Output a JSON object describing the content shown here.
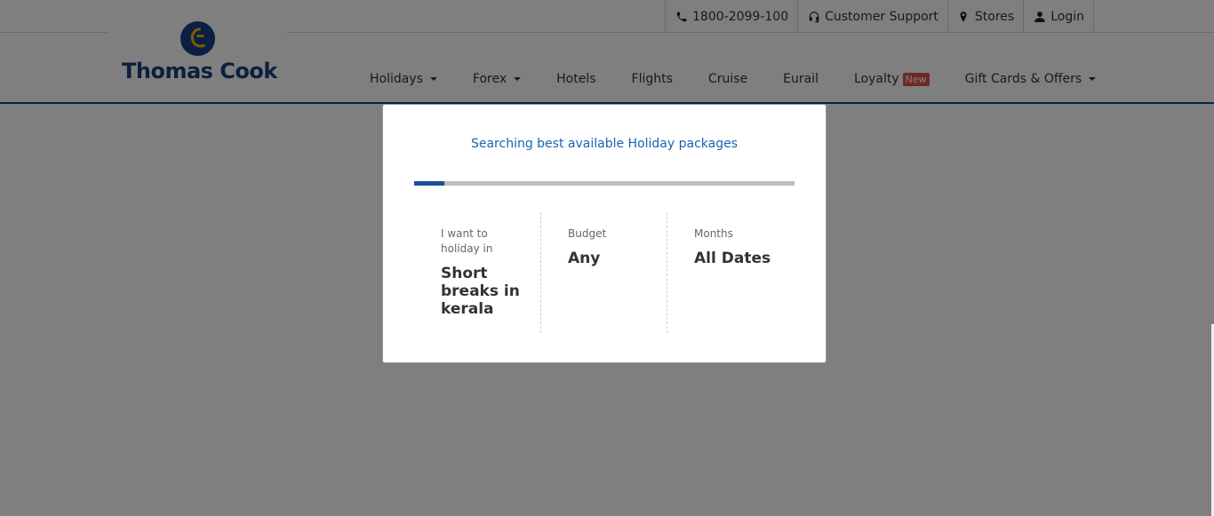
{
  "topbar": {
    "links": [
      {
        "icon": "phone-icon",
        "label": "1800-2099-100"
      },
      {
        "icon": "headset-icon",
        "label": "Customer Support"
      },
      {
        "icon": "map-pin-icon",
        "label": "Stores"
      },
      {
        "icon": "user-icon",
        "label": "Login"
      }
    ]
  },
  "brand": {
    "name": "Thomas Cook",
    "color": "#1b3e7c"
  },
  "nav": {
    "items": [
      {
        "label": "Holidays",
        "dropdown": true
      },
      {
        "label": "Forex",
        "dropdown": true
      },
      {
        "label": "Hotels",
        "dropdown": false
      },
      {
        "label": "Flights",
        "dropdown": false
      },
      {
        "label": "Cruise",
        "dropdown": false
      },
      {
        "label": "Eurail",
        "dropdown": false
      },
      {
        "label": "Loyalty",
        "badge": "New"
      },
      {
        "label": "Gift Cards & Offers",
        "dropdown": true
      }
    ]
  },
  "modal": {
    "title": "Searching best available Holiday packages",
    "progress_percent": 8,
    "accent": "#1a63b5",
    "criteria": [
      {
        "label": "I want to holiday in",
        "value": "Short breaks in kerala"
      },
      {
        "label": "Budget",
        "value": "Any"
      },
      {
        "label": "Months",
        "value": "All Dates"
      }
    ]
  }
}
